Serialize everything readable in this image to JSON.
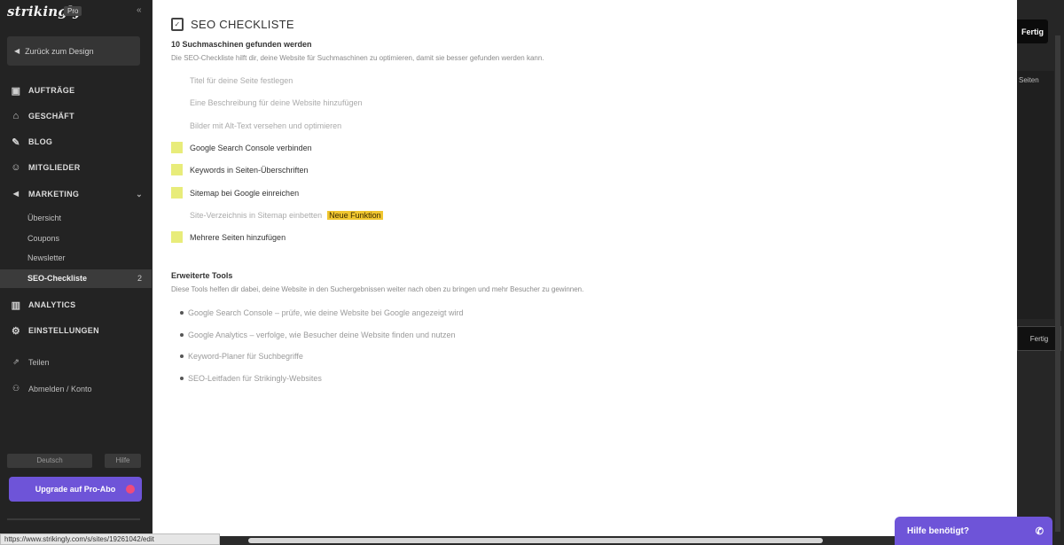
{
  "sidebar": {
    "logo": "strikingly",
    "logo_badge": "Pro",
    "collapse_icon": "double-chevron-left-icon",
    "back_button": "Zurück zum Design",
    "nav": [
      {
        "label": "AUFTRÄGE",
        "icon": "box-icon"
      },
      {
        "label": "GESCHÄFT",
        "icon": "store-icon"
      },
      {
        "label": "BLOG",
        "icon": "blog-icon"
      },
      {
        "label": "MITGLIEDER",
        "icon": "members-icon"
      },
      {
        "label": "MARKETING",
        "icon": "megaphone-icon",
        "expanded": true
      }
    ],
    "marketing_sub": [
      "Übersicht",
      "Coupons",
      "Newsletter"
    ],
    "active_sub": {
      "label": "SEO-Checkliste",
      "count": "2"
    },
    "nav2": [
      {
        "label": "ANALYTICS",
        "icon": "chart-icon"
      },
      {
        "label": "EINSTELLUNGEN",
        "icon": "gear-icon"
      }
    ],
    "extra": [
      {
        "label": "Teilen",
        "icon": "share-icon"
      },
      {
        "label": "Abmelden / Konto",
        "icon": "user-icon"
      }
    ],
    "language": "Deutsch",
    "language_extra": "Hilfe",
    "upgrade": "Upgrade auf Pro-Abo"
  },
  "modal": {
    "title": "SEO CHECKLISTE",
    "subheading": "10 Suchmaschinen gefunden werden",
    "intro": "Die SEO-Checkliste hilft dir, deine Website für Suchmaschinen zu optimieren, damit sie besser gefunden werden kann.",
    "checklist": [
      {
        "text": "Titel für deine Seite festlegen",
        "done": true
      },
      {
        "text": "Eine Beschreibung für deine Website hinzufügen",
        "done": true
      },
      {
        "text": "Bilder mit Alt-Text versehen und optimieren",
        "done": true
      },
      {
        "text": "Google Search Console verbinden",
        "done": false
      },
      {
        "text": "Keywords in Seiten-Überschriften",
        "done": false
      },
      {
        "text": "Sitemap bei Google einreichen",
        "done": false
      },
      {
        "text": "Site-Verzeichnis in Sitemap einbetten",
        "done": true,
        "badge": "Neue Funktion"
      },
      {
        "text": "Mehrere Seiten hinzufügen",
        "done": false
      }
    ],
    "tools_heading": "Erweiterte Tools",
    "tools_intro": "Diese Tools helfen dir dabei, deine Website in den Suchergebnissen weiter nach oben zu bringen und mehr Besucher zu gewinnen.",
    "tools": [
      "Google Search Console – prüfe, wie deine Website bei Google angezeigt wird",
      "Google Analytics – verfolge, wie Besucher deine Website finden und nutzen",
      "Keyword-Planer für Suchbegriffe",
      "SEO-Leitfaden für Strikingly-Websites"
    ]
  },
  "right": {
    "button": "Fertig",
    "panel_text": "Seiten",
    "button2": "Fertig"
  },
  "status_url": "https://www.strikingly.com/s/sites/19261042/edit",
  "chat": {
    "label": "Hilfe benötigt?",
    "icon": "chat-icon"
  }
}
